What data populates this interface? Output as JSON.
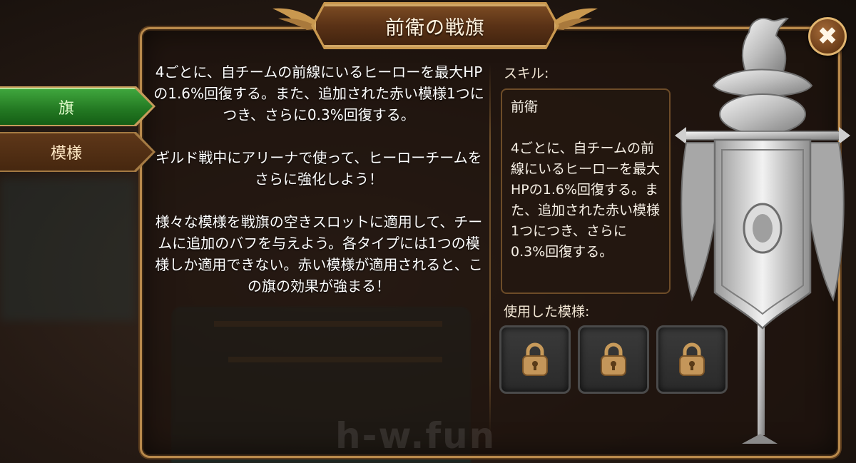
{
  "header": {
    "title": "前衛の戦旗"
  },
  "close_button": {
    "icon": "close-icon",
    "label": "✖"
  },
  "tabs": [
    {
      "label": "旗",
      "active": true
    },
    {
      "label": "模様",
      "active": false
    }
  ],
  "description": {
    "paragraphs": [
      "4ごとに、自チームの前線にいるヒーローを最大HPの1.6%回復する。また、追加された赤い模様1つにつき、さらに0.3%回復する。",
      "ギルド戦中にアリーナで使って、ヒーローチームをさらに強化しよう！",
      "様々な模様を戦旗の空きスロットに適用して、チームに追加のバフを与えよう。各タイプには1つの模様しか適用できない。赤い模様が適用されると、この旗の効果が強まる！"
    ]
  },
  "skill": {
    "label": "スキル:",
    "name": "前衛",
    "text": "4ごとに、自チームの前線にいるヒーローを最大HPの1.6%回復する。また、追加された赤い模様1つにつき、さらに0.3%回復する。"
  },
  "patterns": {
    "label": "使用した模様:",
    "slots": [
      {
        "icon": "padlock-icon",
        "locked": true
      },
      {
        "icon": "padlock-icon",
        "locked": true
      },
      {
        "icon": "padlock-icon",
        "locked": true
      }
    ]
  },
  "watermark": "h-w.fun",
  "colors": {
    "frame_gold": "#b98a4c",
    "tab_active_green": "#247a23",
    "tab_inactive_brown": "#46270f",
    "title_brown": "#5a3216"
  }
}
